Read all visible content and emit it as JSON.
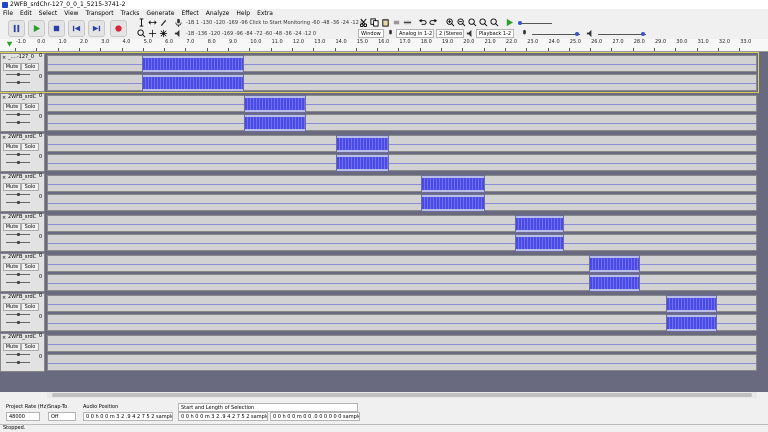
{
  "window": {
    "title": "2WFB_srdChr-127_0_0_1_5215-3741-2"
  },
  "menu": [
    "File",
    "Edit",
    "Select",
    "View",
    "Transport",
    "Tracks",
    "Generate",
    "Effect",
    "Analyze",
    "Help",
    "Extra"
  ],
  "transport": {
    "pause": "pause",
    "play": "play",
    "stop": "stop",
    "skip_start": "skip-start",
    "skip_end": "skip-end",
    "record": "record"
  },
  "meters": {
    "record_scale": "-1B 1 -130 -120 -169 -96 Click to Start Monitoring -60 -48 -36 -24 -12 0",
    "play_scale": "-1B -136 -120 -169 -96 -84 -72 -60 -48 -36 -24 -12 0"
  },
  "devices": {
    "host": "Window",
    "rec_device": "Analog in 1-2",
    "rec_channels": "2 (Stereo",
    "play_device": "Playback 1-2"
  },
  "ruler": [
    "-1.0",
    "0.0",
    "1.0",
    "2.0",
    "3.0",
    "4.0",
    "5.0",
    "6.0",
    "7.0",
    "8.0",
    "9.0",
    "10.0",
    "11.0",
    "12.0",
    "13.0",
    "14.0",
    "15.0",
    "16.0",
    "17.0",
    "18.0",
    "19.0",
    "20.0",
    "21.0",
    "22.0",
    "23.0",
    "24.0",
    "25.0",
    "26.0",
    "27.0",
    "28.0",
    "29.0",
    "30.0",
    "31.0",
    "32.0",
    "33.0"
  ],
  "tracks": [
    {
      "name": "_....-127_0",
      "mute": "Mute",
      "solo": "Solo",
      "clip_start": 5.0,
      "clip_end": 9.8,
      "selected": true
    },
    {
      "name": "2WFB_srdC",
      "mute": "Mute",
      "solo": "Solo",
      "clip_start": 9.8,
      "clip_end": 12.7
    },
    {
      "name": "2WFB_srdC",
      "mute": "Mute",
      "solo": "Solo",
      "clip_start": 14.1,
      "clip_end": 16.6
    },
    {
      "name": "2WFB_srdC",
      "mute": "Mute",
      "solo": "Solo",
      "clip_start": 18.1,
      "clip_end": 21.1
    },
    {
      "name": "2WFB_srdC",
      "mute": "Mute",
      "solo": "Solo",
      "clip_start": 22.5,
      "clip_end": 24.8
    },
    {
      "name": "2WFB_srdC",
      "mute": "Mute",
      "solo": "Solo",
      "clip_start": 26.0,
      "clip_end": 28.4
    },
    {
      "name": "2WFB_srdC",
      "mute": "Mute",
      "solo": "Solo",
      "clip_start": 29.6,
      "clip_end": 32.0
    },
    {
      "name": "2WFB_srdC",
      "mute": "Mute",
      "solo": "Solo",
      "clip_start": null,
      "clip_end": null
    }
  ],
  "lane_scale": {
    "top": "0",
    "bottom": "0"
  },
  "bottom": {
    "rate_label": "Project Rate (Hz)",
    "rate_value": "48000",
    "snap_label": "Snap-To",
    "snap_value": "Off",
    "pos_label": "Audio Position",
    "pos_value": "0 0 h 0 0 m 3 2 .9 4 2 7 5 2 samples",
    "sel_label": "Start and Length of Selection",
    "sel_start": "0 0 h 0 0 m 3 2 .9 4 2 7 5 2 samples",
    "sel_len": "0 0 h 0 0 m 0 0 .0 0 0 0 0 0 samples"
  },
  "status": "Stopped.",
  "colors": {
    "wave": "#4a4ae6",
    "clip_bg": "#b8bde8",
    "lane_bg": "#d2d2d2",
    "track_area": "#696a80",
    "record": "#d7263d",
    "play": "#2aa02a"
  }
}
